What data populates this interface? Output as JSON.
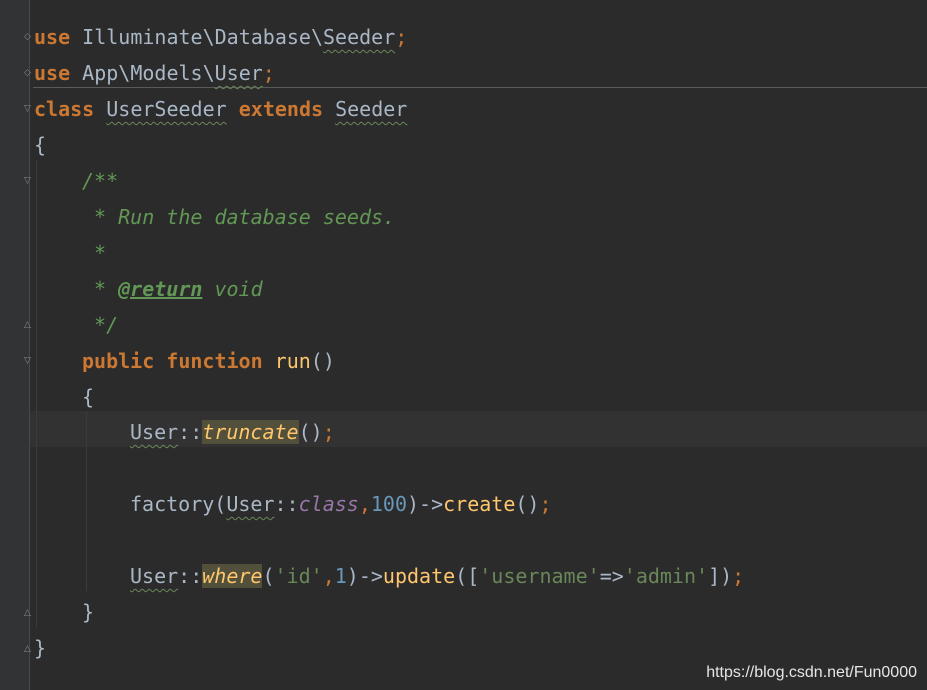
{
  "editor": {
    "lines": {
      "l1": {
        "kw": "use",
        "ns": "Illuminate\\Database\\",
        "cls": "Seeder",
        "end": ";"
      },
      "l2": {
        "kw": "use",
        "ns": "App\\Models\\",
        "cls": "User",
        "end": ";"
      },
      "l3": {
        "kw1": "class",
        "name": "UserSeeder",
        "kw2": "extends",
        "parent": "Seeder"
      },
      "l4": {
        "text": "{"
      },
      "l5": {
        "text": "/**"
      },
      "l6": {
        "text": " * Run the database seeds."
      },
      "l7": {
        "text": " *"
      },
      "l8": {
        "star": " * ",
        "tag": "@return",
        "type": " void"
      },
      "l9": {
        "text": " */"
      },
      "l10": {
        "kw1": "public",
        "kw2": "function",
        "name": "run",
        "args": "()"
      },
      "l11": {
        "text": "{"
      },
      "l12": {
        "cls": "User",
        "op": "::",
        "fn": "truncate",
        "args": "()",
        "end": ";"
      },
      "l13": {
        "fn": "factory",
        "p1": "(",
        "cls": "User",
        "op": "::",
        "cst": "class",
        "comma": ",",
        "num": "100",
        "p2": ")->",
        "fn2": "create",
        "args": "()",
        "end": ";"
      },
      "l14": {
        "cls": "User",
        "op": "::",
        "fn": "where",
        "p1": "(",
        "s1": "'id'",
        "comma": ",",
        "num": "1",
        "p2": ")->",
        "fn2": "update",
        "p3": "([",
        "s2": "'username'",
        "arrow": "=>",
        "s3": "'admin'",
        "p4": "])",
        "end": ";"
      },
      "l15": {
        "text": "}"
      },
      "l16": {
        "text": "}"
      }
    },
    "colors": {
      "background": "#2b2b2b",
      "keyword": "#cc7832",
      "function": "#ffc66d",
      "string": "#6a8759",
      "number": "#6897bb",
      "doc_comment": "#629755",
      "constant": "#9876aa",
      "default_text": "#a9b7c6"
    }
  },
  "watermark": "https://blog.csdn.net/Fun0000"
}
